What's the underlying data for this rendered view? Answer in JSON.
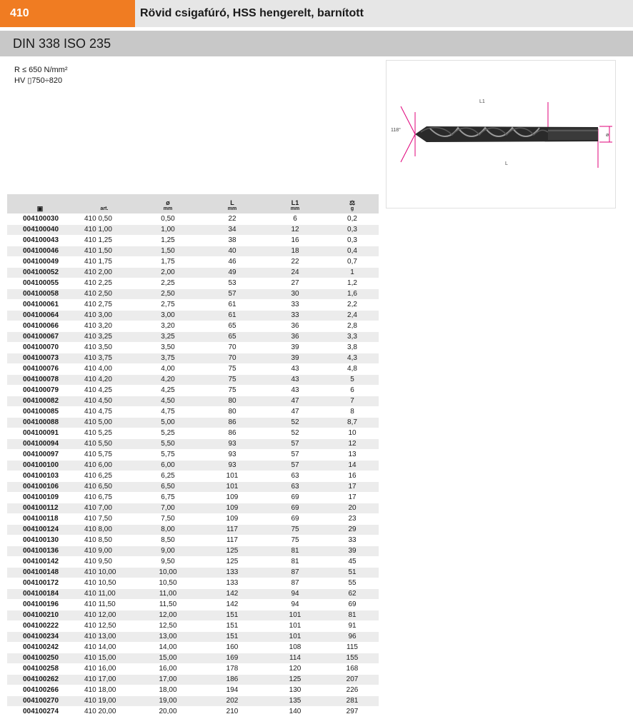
{
  "header": {
    "code": "410",
    "title": "Rövid csigafúró, HSS hengerelt,  barnított"
  },
  "standard": "DIN 338 ISO 235",
  "specs": {
    "line1": "R ≤ 650 N/mm²",
    "line2": "HV ▯750÷820"
  },
  "drawing": {
    "angle_label": "118°",
    "l1_label": "L1",
    "l_label": "L",
    "diameter_label": "ø"
  },
  "table": {
    "headers": [
      {
        "sym": "▣",
        "unit": ""
      },
      {
        "sym": "",
        "unit": "art."
      },
      {
        "sym": "ø",
        "unit": "mm"
      },
      {
        "sym": "L",
        "unit": "mm"
      },
      {
        "sym": "L1",
        "unit": "mm"
      },
      {
        "sym": "⚖",
        "unit": "g"
      }
    ],
    "rows": [
      [
        "004100030",
        "410 0,50",
        "0,50",
        "22",
        "6",
        "0,2"
      ],
      [
        "004100040",
        "410 1,00",
        "1,00",
        "34",
        "12",
        "0,3"
      ],
      [
        "004100043",
        "410 1,25",
        "1,25",
        "38",
        "16",
        "0,3"
      ],
      [
        "004100046",
        "410 1,50",
        "1,50",
        "40",
        "18",
        "0,4"
      ],
      [
        "004100049",
        "410 1,75",
        "1,75",
        "46",
        "22",
        "0,7"
      ],
      [
        "004100052",
        "410 2,00",
        "2,00",
        "49",
        "24",
        "1"
      ],
      [
        "004100055",
        "410 2,25",
        "2,25",
        "53",
        "27",
        "1,2"
      ],
      [
        "004100058",
        "410 2,50",
        "2,50",
        "57",
        "30",
        "1,6"
      ],
      [
        "004100061",
        "410 2,75",
        "2,75",
        "61",
        "33",
        "2,2"
      ],
      [
        "004100064",
        "410 3,00",
        "3,00",
        "61",
        "33",
        "2,4"
      ],
      [
        "004100066",
        "410 3,20",
        "3,20",
        "65",
        "36",
        "2,8"
      ],
      [
        "004100067",
        "410 3,25",
        "3,25",
        "65",
        "36",
        "3,3"
      ],
      [
        "004100070",
        "410 3,50",
        "3,50",
        "70",
        "39",
        "3,8"
      ],
      [
        "004100073",
        "410 3,75",
        "3,75",
        "70",
        "39",
        "4,3"
      ],
      [
        "004100076",
        "410 4,00",
        "4,00",
        "75",
        "43",
        "4,8"
      ],
      [
        "004100078",
        "410 4,20",
        "4,20",
        "75",
        "43",
        "5"
      ],
      [
        "004100079",
        "410 4,25",
        "4,25",
        "75",
        "43",
        "6"
      ],
      [
        "004100082",
        "410 4,50",
        "4,50",
        "80",
        "47",
        "7"
      ],
      [
        "004100085",
        "410 4,75",
        "4,75",
        "80",
        "47",
        "8"
      ],
      [
        "004100088",
        "410 5,00",
        "5,00",
        "86",
        "52",
        "8,7"
      ],
      [
        "004100091",
        "410 5,25",
        "5,25",
        "86",
        "52",
        "10"
      ],
      [
        "004100094",
        "410 5,50",
        "5,50",
        "93",
        "57",
        "12"
      ],
      [
        "004100097",
        "410 5,75",
        "5,75",
        "93",
        "57",
        "13"
      ],
      [
        "004100100",
        "410 6,00",
        "6,00",
        "93",
        "57",
        "14"
      ],
      [
        "004100103",
        "410 6,25",
        "6,25",
        "101",
        "63",
        "16"
      ],
      [
        "004100106",
        "410 6,50",
        "6,50",
        "101",
        "63",
        "17"
      ],
      [
        "004100109",
        "410 6,75",
        "6,75",
        "109",
        "69",
        "17"
      ],
      [
        "004100112",
        "410 7,00",
        "7,00",
        "109",
        "69",
        "20"
      ],
      [
        "004100118",
        "410 7,50",
        "7,50",
        "109",
        "69",
        "23"
      ],
      [
        "004100124",
        "410 8,00",
        "8,00",
        "117",
        "75",
        "29"
      ],
      [
        "004100130",
        "410 8,50",
        "8,50",
        "117",
        "75",
        "33"
      ],
      [
        "004100136",
        "410 9,00",
        "9,00",
        "125",
        "81",
        "39"
      ],
      [
        "004100142",
        "410 9,50",
        "9,50",
        "125",
        "81",
        "45"
      ],
      [
        "004100148",
        "410 10,00",
        "10,00",
        "133",
        "87",
        "51"
      ],
      [
        "004100172",
        "410 10,50",
        "10,50",
        "133",
        "87",
        "55"
      ],
      [
        "004100184",
        "410 11,00",
        "11,00",
        "142",
        "94",
        "62"
      ],
      [
        "004100196",
        "410 11,50",
        "11,50",
        "142",
        "94",
        "69"
      ],
      [
        "004100210",
        "410 12,00",
        "12,00",
        "151",
        "101",
        "81"
      ],
      [
        "004100222",
        "410 12,50",
        "12,50",
        "151",
        "101",
        "91"
      ],
      [
        "004100234",
        "410 13,00",
        "13,00",
        "151",
        "101",
        "96"
      ],
      [
        "004100242",
        "410 14,00",
        "14,00",
        "160",
        "108",
        "115"
      ],
      [
        "004100250",
        "410 15,00",
        "15,00",
        "169",
        "114",
        "155"
      ],
      [
        "004100258",
        "410 16,00",
        "16,00",
        "178",
        "120",
        "168"
      ],
      [
        "004100262",
        "410 17,00",
        "17,00",
        "186",
        "125",
        "207"
      ],
      [
        "004100266",
        "410 18,00",
        "18,00",
        "194",
        "130",
        "226"
      ],
      [
        "004100270",
        "410 19,00",
        "19,00",
        "202",
        "135",
        "281"
      ],
      [
        "004100274",
        "410 20,00",
        "20,00",
        "210",
        "140",
        "297"
      ]
    ]
  },
  "colors": {
    "accent": "#f07c22",
    "dimension_lines": "#e0007a"
  }
}
